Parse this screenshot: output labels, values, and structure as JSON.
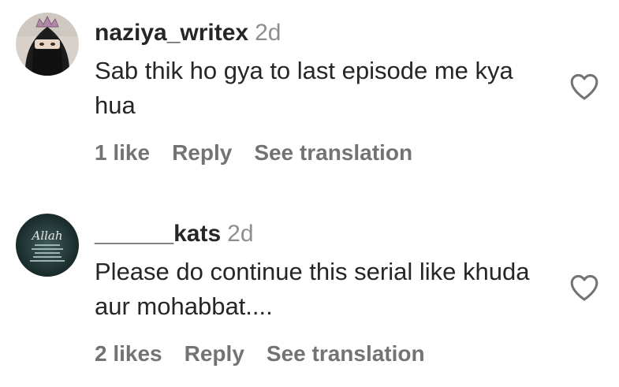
{
  "comments": [
    {
      "username": "naziya_writex",
      "timestamp": "2d",
      "text": "Sab thik ho gya to last episode me kya hua",
      "likes": "1 like",
      "reply_label": "Reply",
      "translate_label": "See translation",
      "avatar_icon": "avatar-niqab-crown"
    },
    {
      "username": "______kats",
      "timestamp": "2d",
      "text": "Please do continue this serial like khuda aur mohabbat....",
      "likes": "2 likes",
      "reply_label": "Reply",
      "translate_label": "See translation",
      "avatar_icon": "avatar-allah-quote",
      "avatar_text": "Allah"
    }
  ],
  "colors": {
    "text": "#262626",
    "secondary": "#737373",
    "timestamp": "#8e8e8e"
  },
  "icons": {
    "like": "heart-outline-icon"
  }
}
